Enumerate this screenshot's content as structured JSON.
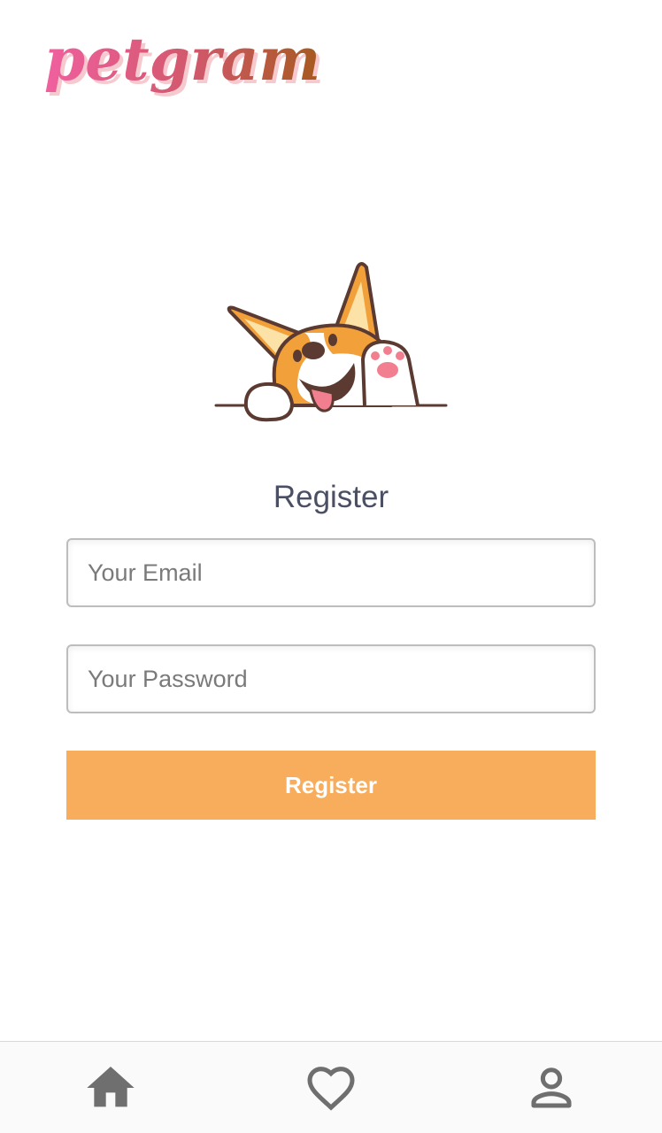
{
  "app": {
    "logo_text": "petgram"
  },
  "colors": {
    "logo_gradient_start": "#f0609f",
    "logo_gradient_end": "#a65a1e",
    "accent": "#f8ad5c",
    "title": "#4a4f63",
    "icon": "#6f6f6f"
  },
  "form": {
    "title": "Register",
    "email_placeholder": "Your Email",
    "password_placeholder": "Your Password",
    "submit_label": "Register"
  },
  "nav": {
    "items": [
      {
        "icon": "home-icon"
      },
      {
        "icon": "heart-icon"
      },
      {
        "icon": "user-icon"
      }
    ]
  }
}
